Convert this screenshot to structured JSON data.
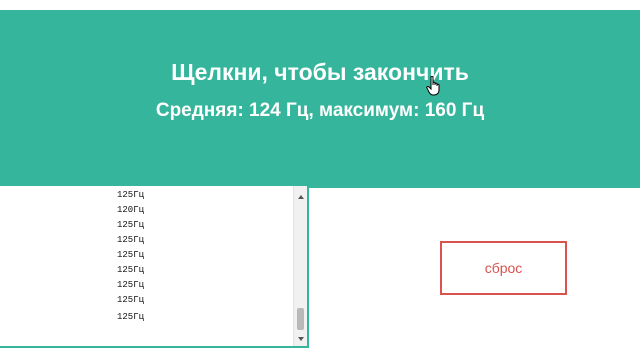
{
  "banner": {
    "title": "Щелкни, чтобы закончить",
    "stats": "Средняя: 124 Гц, максимум: 160 Гц",
    "color": "#35b59b"
  },
  "log": {
    "entries": [
      "125Гц",
      "120Гц",
      "125Гц",
      "125Гц",
      "125Гц",
      "125Гц",
      "125Гц",
      "125Гц",
      "125Гц"
    ]
  },
  "reset": {
    "label": "сброс",
    "color": "#d9534f"
  }
}
